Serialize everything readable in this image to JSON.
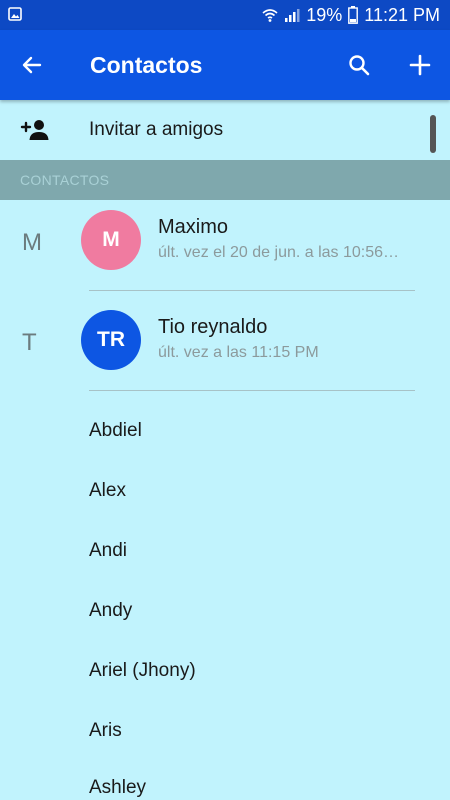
{
  "status_bar": {
    "battery": "19%",
    "time": "11:21 PM",
    "icons": [
      "image-notification-icon",
      "wifi-icon",
      "signal-icon",
      "battery-icon"
    ]
  },
  "app_bar": {
    "title": "Contactos",
    "icons": [
      "back-arrow-icon",
      "search-icon",
      "add-icon"
    ]
  },
  "invite": {
    "label": "Invitar a amigos",
    "icon": "add-person-icon"
  },
  "section": {
    "label": "CONTACTOS"
  },
  "recent_contacts": [
    {
      "letter": "M",
      "initials": "M",
      "name": "Maximo",
      "status": "últ. vez el 20 de jun. a las 10:56…",
      "avatar_color": "#f07ba0"
    },
    {
      "letter": "T",
      "initials": "TR",
      "name": "Tio reynaldo",
      "status": "últ. vez a las 11:15 PM",
      "avatar_color": "#0d56e3"
    }
  ],
  "contacts": [
    "Abdiel",
    "Alex",
    "Andi",
    "Andy",
    "Ariel (Jhony)",
    "Aris",
    "Ashley"
  ],
  "colors": {
    "status_bar": "#0d49c4",
    "app_bar": "#0d56e3",
    "background": "#c1f3fd",
    "section_header": "#7fa8ad"
  }
}
